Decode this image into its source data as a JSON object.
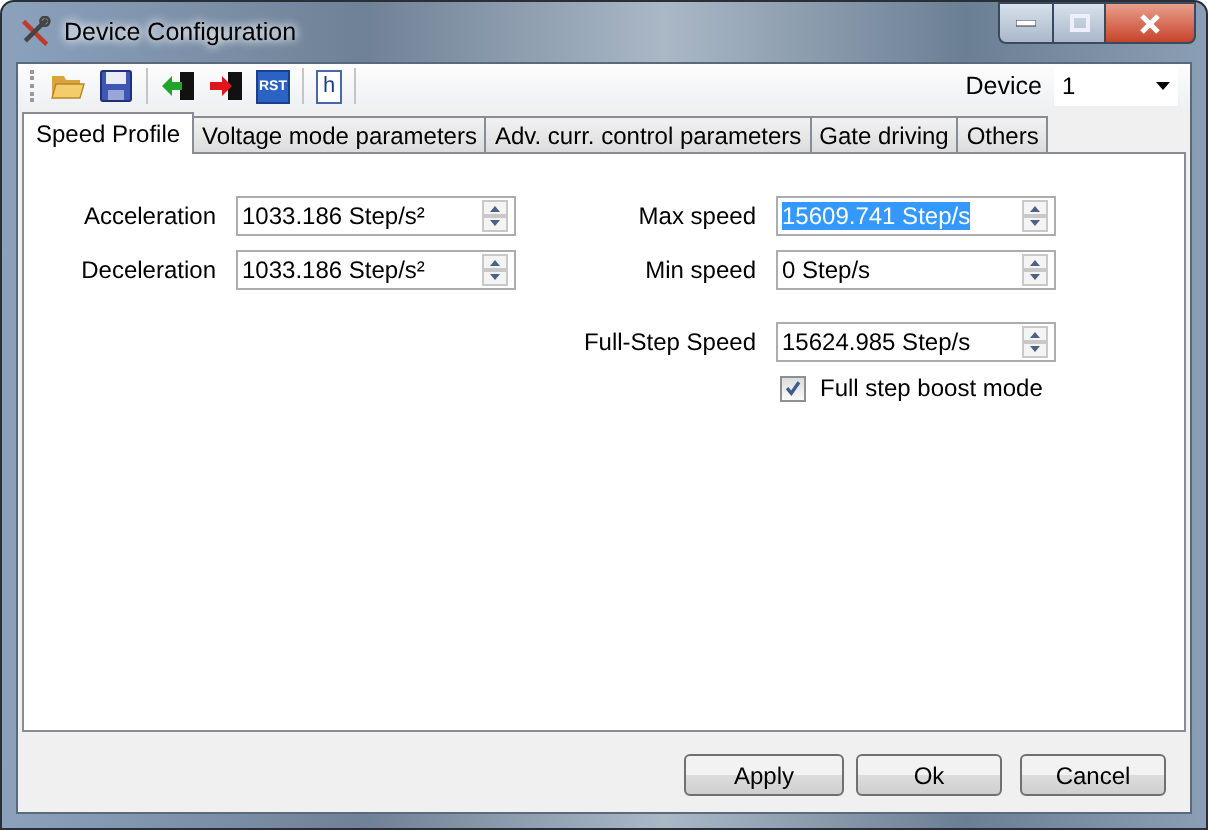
{
  "window": {
    "title": "Device Configuration"
  },
  "toolbar": {
    "rst_text": "RST",
    "help_text": "h",
    "device_label": "Device",
    "device_value": "1"
  },
  "tabs": [
    {
      "label": "Speed Profile",
      "selected": true
    },
    {
      "label": "Voltage mode parameters",
      "selected": false
    },
    {
      "label": "Adv. curr. control parameters",
      "selected": false
    },
    {
      "label": "Gate driving",
      "selected": false
    },
    {
      "label": "Others",
      "selected": false
    }
  ],
  "speed_profile": {
    "left_fields": [
      {
        "label": "Acceleration",
        "value": "1033.186 Step/s²",
        "selected": false
      },
      {
        "label": "Deceleration",
        "value": "1033.186 Step/s²",
        "selected": false
      }
    ],
    "right_fields": [
      {
        "label": "Max speed",
        "value": "15609.741 Step/s",
        "selected": true
      },
      {
        "label": "Min speed",
        "value": "0 Step/s",
        "selected": false
      },
      {
        "label": "Full-Step Speed",
        "value": "15624.985 Step/s",
        "selected": false
      }
    ],
    "full_step_boost": {
      "label": "Full step boost mode",
      "checked": true
    }
  },
  "buttons": [
    "Apply",
    "Ok",
    "Cancel"
  ]
}
